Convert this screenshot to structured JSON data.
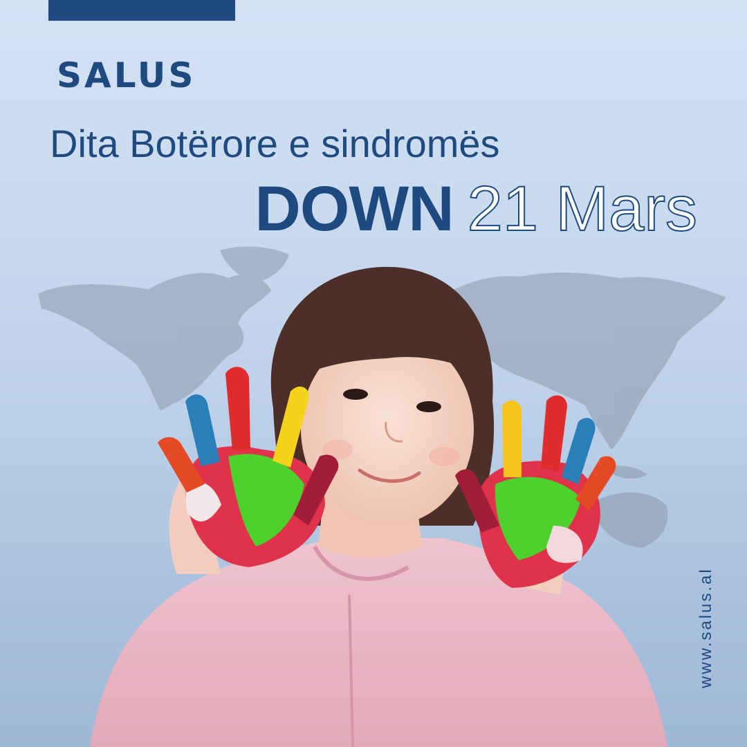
{
  "brand": {
    "name": "SALUS"
  },
  "headline": {
    "line1": "Dita Botërore e sindromës",
    "emphasis": "DOWN",
    "date": "21 Mars"
  },
  "footer": {
    "url": "www.salus.al"
  },
  "colors": {
    "brand_blue": "#1f4a80",
    "background_light": "#d3e1f3",
    "background_dark": "#9fb8d6",
    "map_gray": "#8a98ab",
    "shirt_pink": "#e9b8c6"
  },
  "icons": [
    "world-map-icon"
  ]
}
